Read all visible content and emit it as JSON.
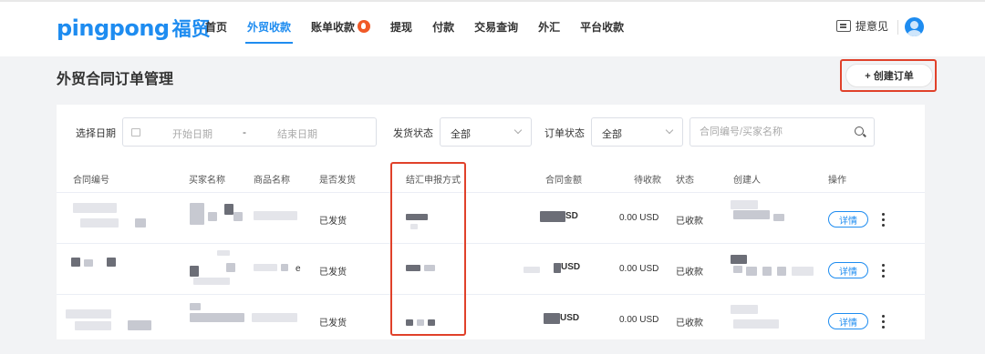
{
  "brand": {
    "name_en": "pingpong",
    "name_cn": "福贸"
  },
  "nav": {
    "items": [
      {
        "label": "首页",
        "active": false
      },
      {
        "label": "外贸收款",
        "active": true
      },
      {
        "label": "账单收款",
        "active": false,
        "badge_icon": "fire-icon"
      },
      {
        "label": "提现",
        "active": false
      },
      {
        "label": "付款",
        "active": false
      },
      {
        "label": "交易查询",
        "active": false
      },
      {
        "label": "外汇",
        "active": false
      },
      {
        "label": "平台收款",
        "active": false
      }
    ]
  },
  "header_right": {
    "feedback_label": "提意见",
    "feedback_icon": "edit-icon",
    "avatar_icon": "user-avatar-icon"
  },
  "page": {
    "title": "外贸合同订单管理",
    "create_button": "+ 创建订单"
  },
  "filters": {
    "date_label": "选择日期",
    "date_start_placeholder": "开始日期",
    "date_separator": "-",
    "date_end_placeholder": "结束日期",
    "shipping_label": "发货状态",
    "shipping_value": "全部",
    "order_status_label": "订单状态",
    "order_status_value": "全部",
    "search_placeholder": "合同编号/买家名称"
  },
  "table": {
    "headers": [
      "合同编号",
      "买家名称",
      "商品名称",
      "是否发货",
      "结汇申报方式",
      "合同金额",
      "待收款",
      "状态",
      "创建人",
      "操作"
    ],
    "rows": [
      {
        "shipped": "已发货",
        "amount_suffix": "SD",
        "pending": "0.00 USD",
        "status": "已收款",
        "detail": "详情"
      },
      {
        "shipped": "已发货",
        "amount_suffix": "USD",
        "pending": "0.00 USD",
        "status": "已收款",
        "detail": "详情"
      },
      {
        "shipped": "已发货",
        "amount_suffix": "USD",
        "pending": "0.00 USD",
        "status": "已收款",
        "detail": "详情"
      }
    ]
  },
  "colors": {
    "accent": "#1e8cf0",
    "highlight": "#e0412a",
    "page_bg": "#f2f3f5"
  }
}
